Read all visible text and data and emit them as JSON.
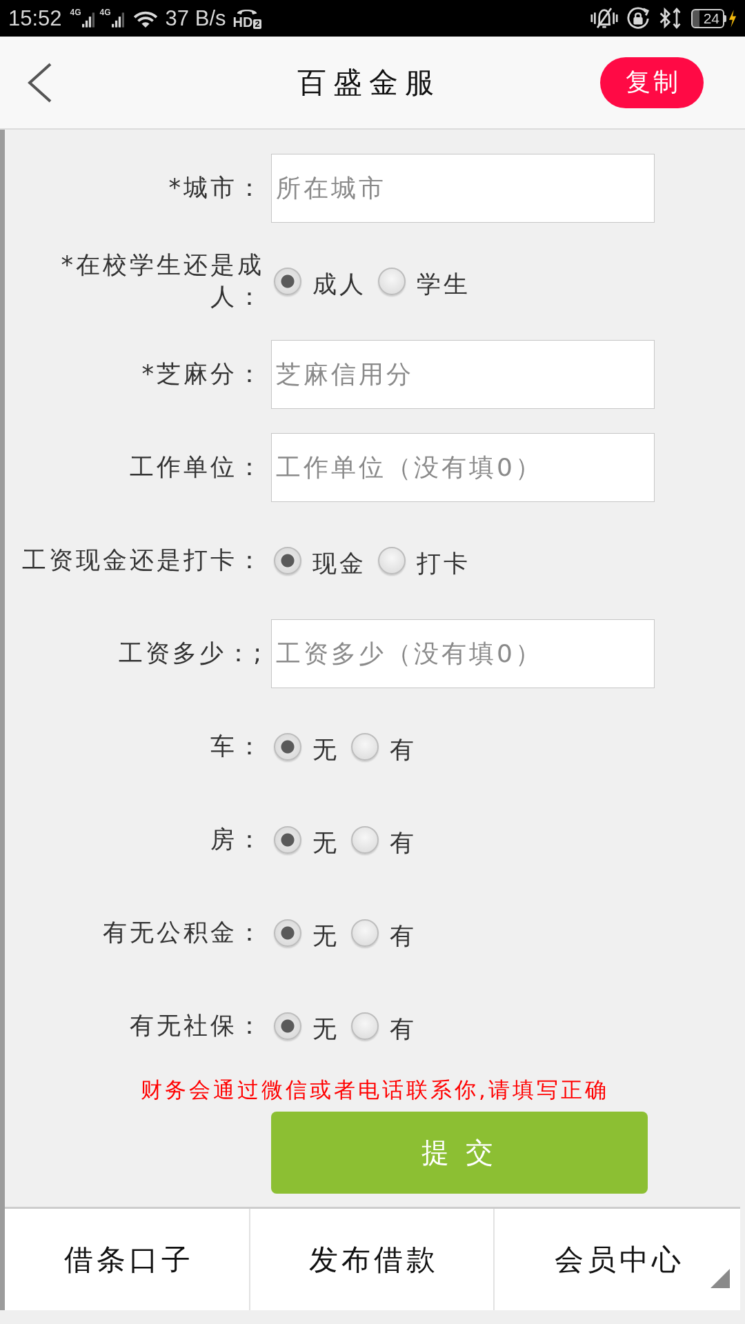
{
  "status_bar": {
    "time": "15:52",
    "signals": [
      {
        "label": "4G"
      },
      {
        "label": "4G"
      }
    ],
    "speed": "37 B/s",
    "hd": "HD",
    "hd_index": "2",
    "battery": "24"
  },
  "header": {
    "title": "百盛金服",
    "copy_button": "复制"
  },
  "form": {
    "fields": [
      {
        "kind": "text",
        "label": "*城市：",
        "placeholder": "所在城市"
      },
      {
        "kind": "radio",
        "label": "*在校学生还是成人：",
        "options": [
          {
            "label": "成人",
            "selected": true
          },
          {
            "label": "学生",
            "selected": false
          }
        ]
      },
      {
        "kind": "text",
        "label": "*芝麻分：",
        "placeholder": "芝麻信用分"
      },
      {
        "kind": "text",
        "label": "工作单位：",
        "placeholder": "工作单位（没有填0）"
      },
      {
        "kind": "radio",
        "label": "工资现金还是打卡：",
        "options": [
          {
            "label": "现金",
            "selected": true
          },
          {
            "label": "打卡",
            "selected": false
          }
        ]
      },
      {
        "kind": "text",
        "label": "工资多少：;",
        "placeholder": "工资多少（没有填0）"
      },
      {
        "kind": "radio",
        "label": "车：",
        "options": [
          {
            "label": "无",
            "selected": true
          },
          {
            "label": "有",
            "selected": false
          }
        ]
      },
      {
        "kind": "radio",
        "label": "房：",
        "options": [
          {
            "label": "无",
            "selected": true
          },
          {
            "label": "有",
            "selected": false
          }
        ]
      },
      {
        "kind": "radio",
        "label": "有无公积金：",
        "options": [
          {
            "label": "无",
            "selected": true
          },
          {
            "label": "有",
            "selected": false
          }
        ]
      },
      {
        "kind": "radio",
        "label": "有无社保：",
        "options": [
          {
            "label": "无",
            "selected": true
          },
          {
            "label": "有",
            "selected": false
          }
        ]
      }
    ],
    "notice": "财务会通过微信或者电话联系你,请填写正确",
    "submit": "提 交"
  },
  "bottom_nav": [
    {
      "label": "借条口子"
    },
    {
      "label": "发布借款"
    },
    {
      "label": "会员中心"
    }
  ]
}
